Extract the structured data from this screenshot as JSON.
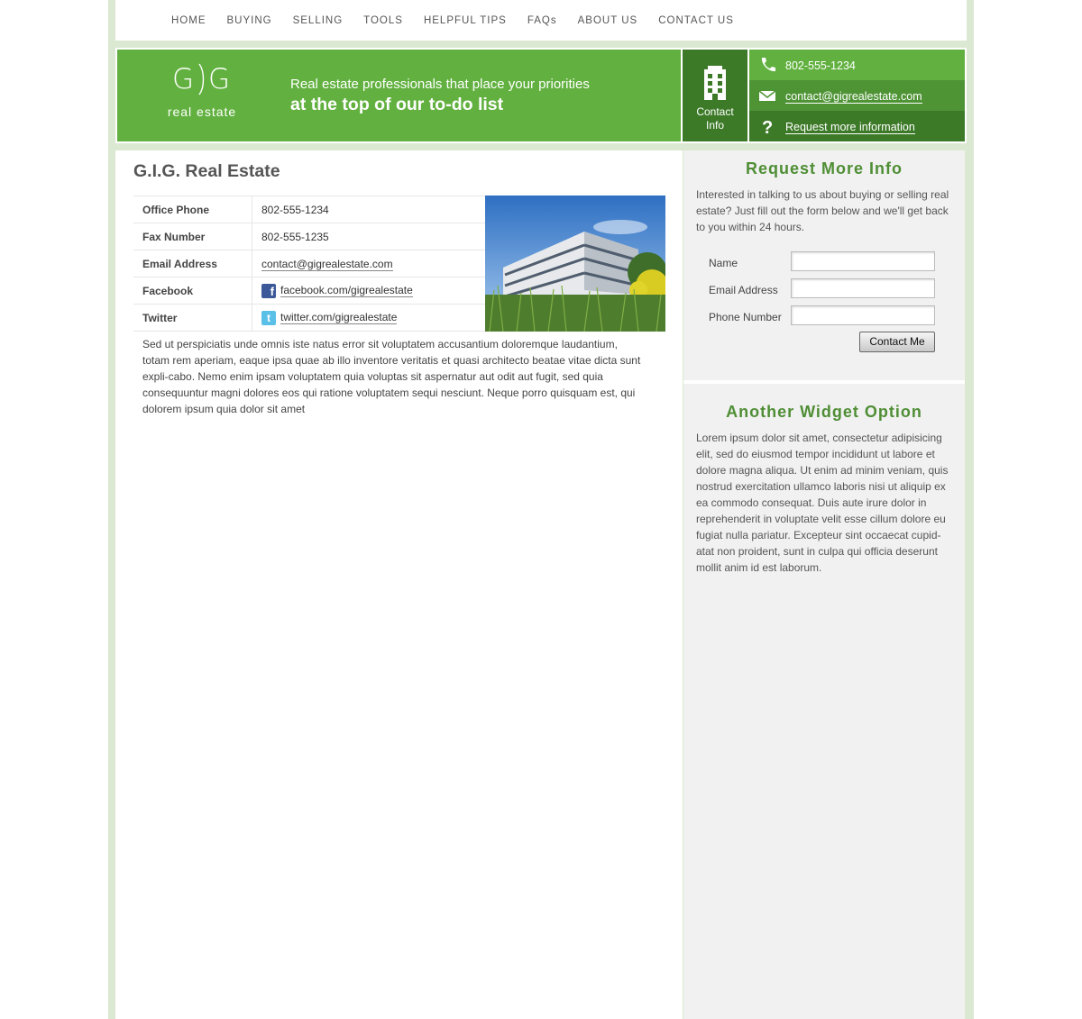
{
  "nav": {
    "items": [
      {
        "label": "HOME"
      },
      {
        "label": "BUYING"
      },
      {
        "label": "SELLING"
      },
      {
        "label": "TOOLS"
      },
      {
        "label": "HELPFUL TIPS"
      },
      {
        "label": "FAQs"
      },
      {
        "label": "ABOUT US"
      },
      {
        "label": "CONTACT US"
      }
    ]
  },
  "header": {
    "logo_mark": "G G",
    "logo_sub": "real estate",
    "tagline_1": "Real estate professionals that place your priorities",
    "tagline_2": "at the top of our to-do list",
    "contact_box_line1": "Contact",
    "contact_box_line2": "Info",
    "phone": "802-555-1234",
    "email": "contact@gigrealestate.com",
    "request": "Request more information",
    "colors": {
      "primary_green": "#62b140",
      "dark_green": "#3d7a28"
    }
  },
  "main": {
    "title": "G.I.G. Real Estate",
    "rows": [
      {
        "key": "Office Phone",
        "value": "802-555-1234"
      },
      {
        "key": "Fax Number",
        "value": "802-555-1235"
      },
      {
        "key": "Email Address",
        "value": "contact@gigrealestate.com"
      },
      {
        "key": "Facebook",
        "value": "facebook.com/gigrealestate",
        "icon": "facebook-icon"
      },
      {
        "key": "Twitter",
        "value": "twitter.com/gigrealestate",
        "icon": "twitter-icon"
      }
    ],
    "paragraph": "Sed ut perspiciatis unde omnis iste natus error sit voluptatem accusantium doloremque laudantium, totam rem aperiam, eaque ipsa quae ab illo inventore veritatis et quasi architecto beatae vitae dicta sunt expli-cabo. Nemo enim ipsam voluptatem quia voluptas sit aspernatur aut odit aut fugit, sed quia consequuntur magni dolores eos qui ratione voluptatem sequi nesciunt. Neque porro quisquam est, qui dolorem ipsum quia dolor sit amet"
  },
  "sidebar": {
    "widget1": {
      "title": "Request More Info",
      "text": "Interested in talking to us about buying or selling real estate? Just fill out the form below and we'll get back to you within 24 hours.",
      "fields": [
        {
          "label": "Name",
          "value": "",
          "placeholder": ""
        },
        {
          "label": "Email Address",
          "value": "",
          "placeholder": ""
        },
        {
          "label": "Phone Number",
          "value": "",
          "placeholder": ""
        }
      ],
      "button": "Contact Me"
    },
    "widget2": {
      "title": "Another Widget Option",
      "text": "Lorem ipsum dolor sit amet, consectetur adipisicing elit, sed do eiusmod tempor incididunt ut labore et dolore magna aliqua. Ut enim ad minim veniam, quis nostrud exercitation ullamco laboris nisi ut aliquip ex ea commodo consequat. Duis aute irure dolor in reprehenderit in voluptate velit esse cillum dolore eu fugiat nulla pariatur. Excepteur sint occaecat cupid-atat non proident, sunt in culpa qui officia deserunt mollit anim id est laborum."
    }
  }
}
